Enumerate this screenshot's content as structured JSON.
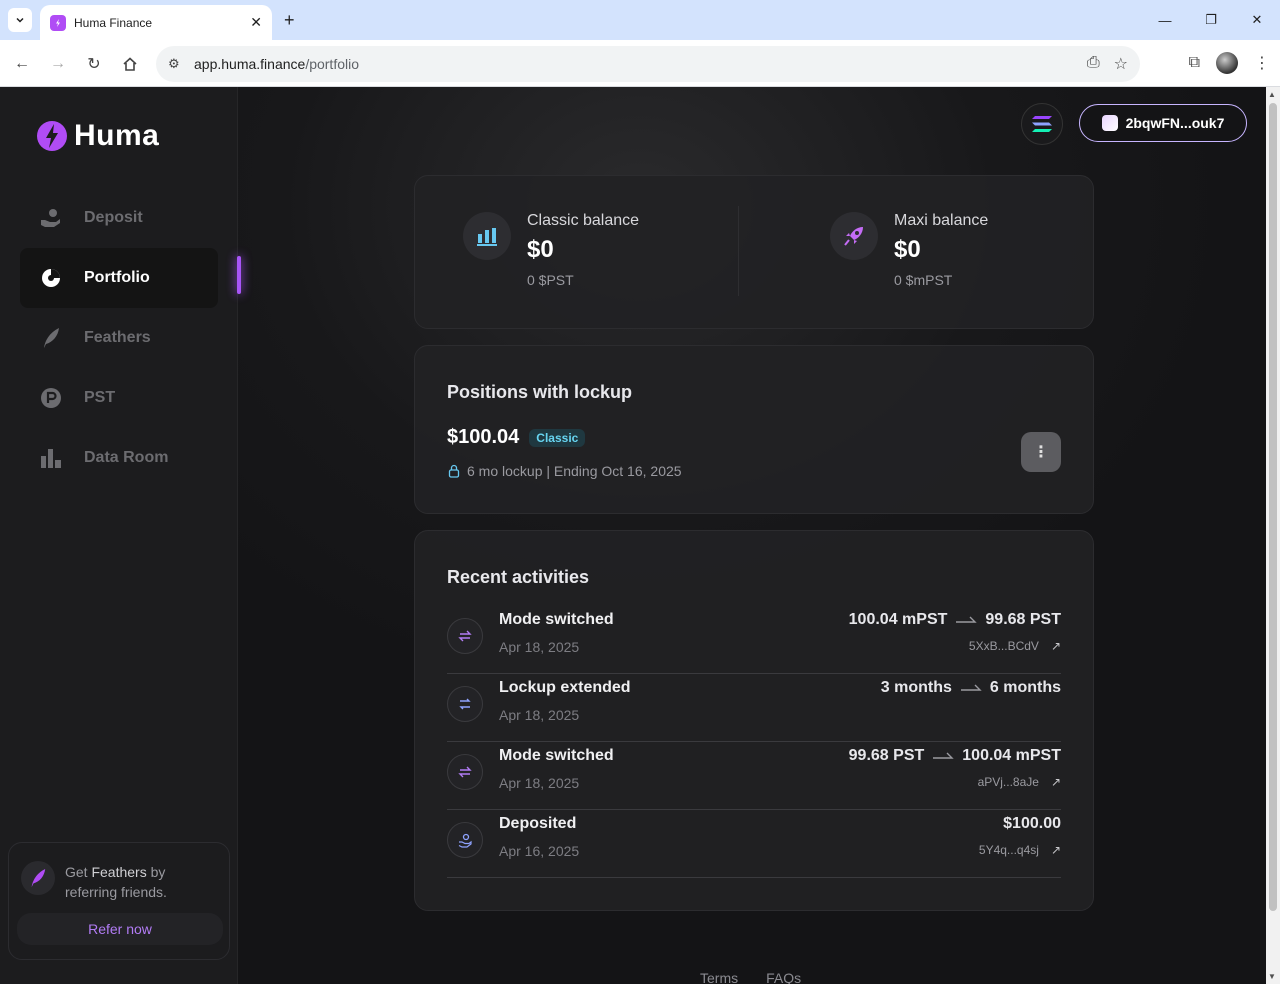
{
  "browser": {
    "tab_title": "Huma Finance",
    "url_host": "app.huma.finance",
    "url_path": "/portfolio"
  },
  "sidebar": {
    "brand": "Huma",
    "items": [
      {
        "label": "Deposit",
        "icon": "deposit-hand-icon"
      },
      {
        "label": "Portfolio",
        "icon": "pie-chart-icon",
        "active": true
      },
      {
        "label": "Feathers",
        "icon": "feather-icon"
      },
      {
        "label": "PST",
        "icon": "pst-coin-icon"
      },
      {
        "label": "Data Room",
        "icon": "bar-chart-icon"
      }
    ],
    "refer": {
      "text_pre": "Get ",
      "text_bold": "Feathers",
      "text_post": " by referring friends.",
      "button": "Refer now"
    }
  },
  "header": {
    "wallet_address": "2bqwFN...ouk7"
  },
  "balances": {
    "classic": {
      "title": "Classic balance",
      "value": "$0",
      "sub": "0 $PST"
    },
    "maxi": {
      "title": "Maxi balance",
      "value": "$0",
      "sub": "0 $mPST"
    }
  },
  "positions": {
    "title": "Positions with lockup",
    "amount": "$100.04",
    "badge": "Classic",
    "lockup": "6 mo lockup | Ending Oct 16, 2025"
  },
  "activities": {
    "title": "Recent activities",
    "rows": [
      {
        "title": "Mode switched",
        "date": "Apr 18, 2025",
        "from": "100.04 mPST",
        "to": "99.68 PST",
        "tx": "5XxB...BCdV",
        "icon": "switch-icon"
      },
      {
        "title": "Lockup extended",
        "date": "Apr 18, 2025",
        "from": "3 months",
        "to": "6 months",
        "tx": "",
        "icon": "extend-icon"
      },
      {
        "title": "Mode switched",
        "date": "Apr 18, 2025",
        "from": "99.68 PST",
        "to": "100.04 mPST",
        "tx": "aPVj...8aJe",
        "icon": "switch-icon"
      },
      {
        "title": "Deposited",
        "date": "Apr 16, 2025",
        "from": "",
        "to": "$100.00",
        "tx": "5Y4q...q4sj",
        "icon": "deposit-icon"
      }
    ]
  },
  "footer": {
    "terms": "Terms",
    "faqs": "FAQs"
  },
  "colors": {
    "accent": "#a855f7",
    "badge_text": "#67d4f0"
  }
}
